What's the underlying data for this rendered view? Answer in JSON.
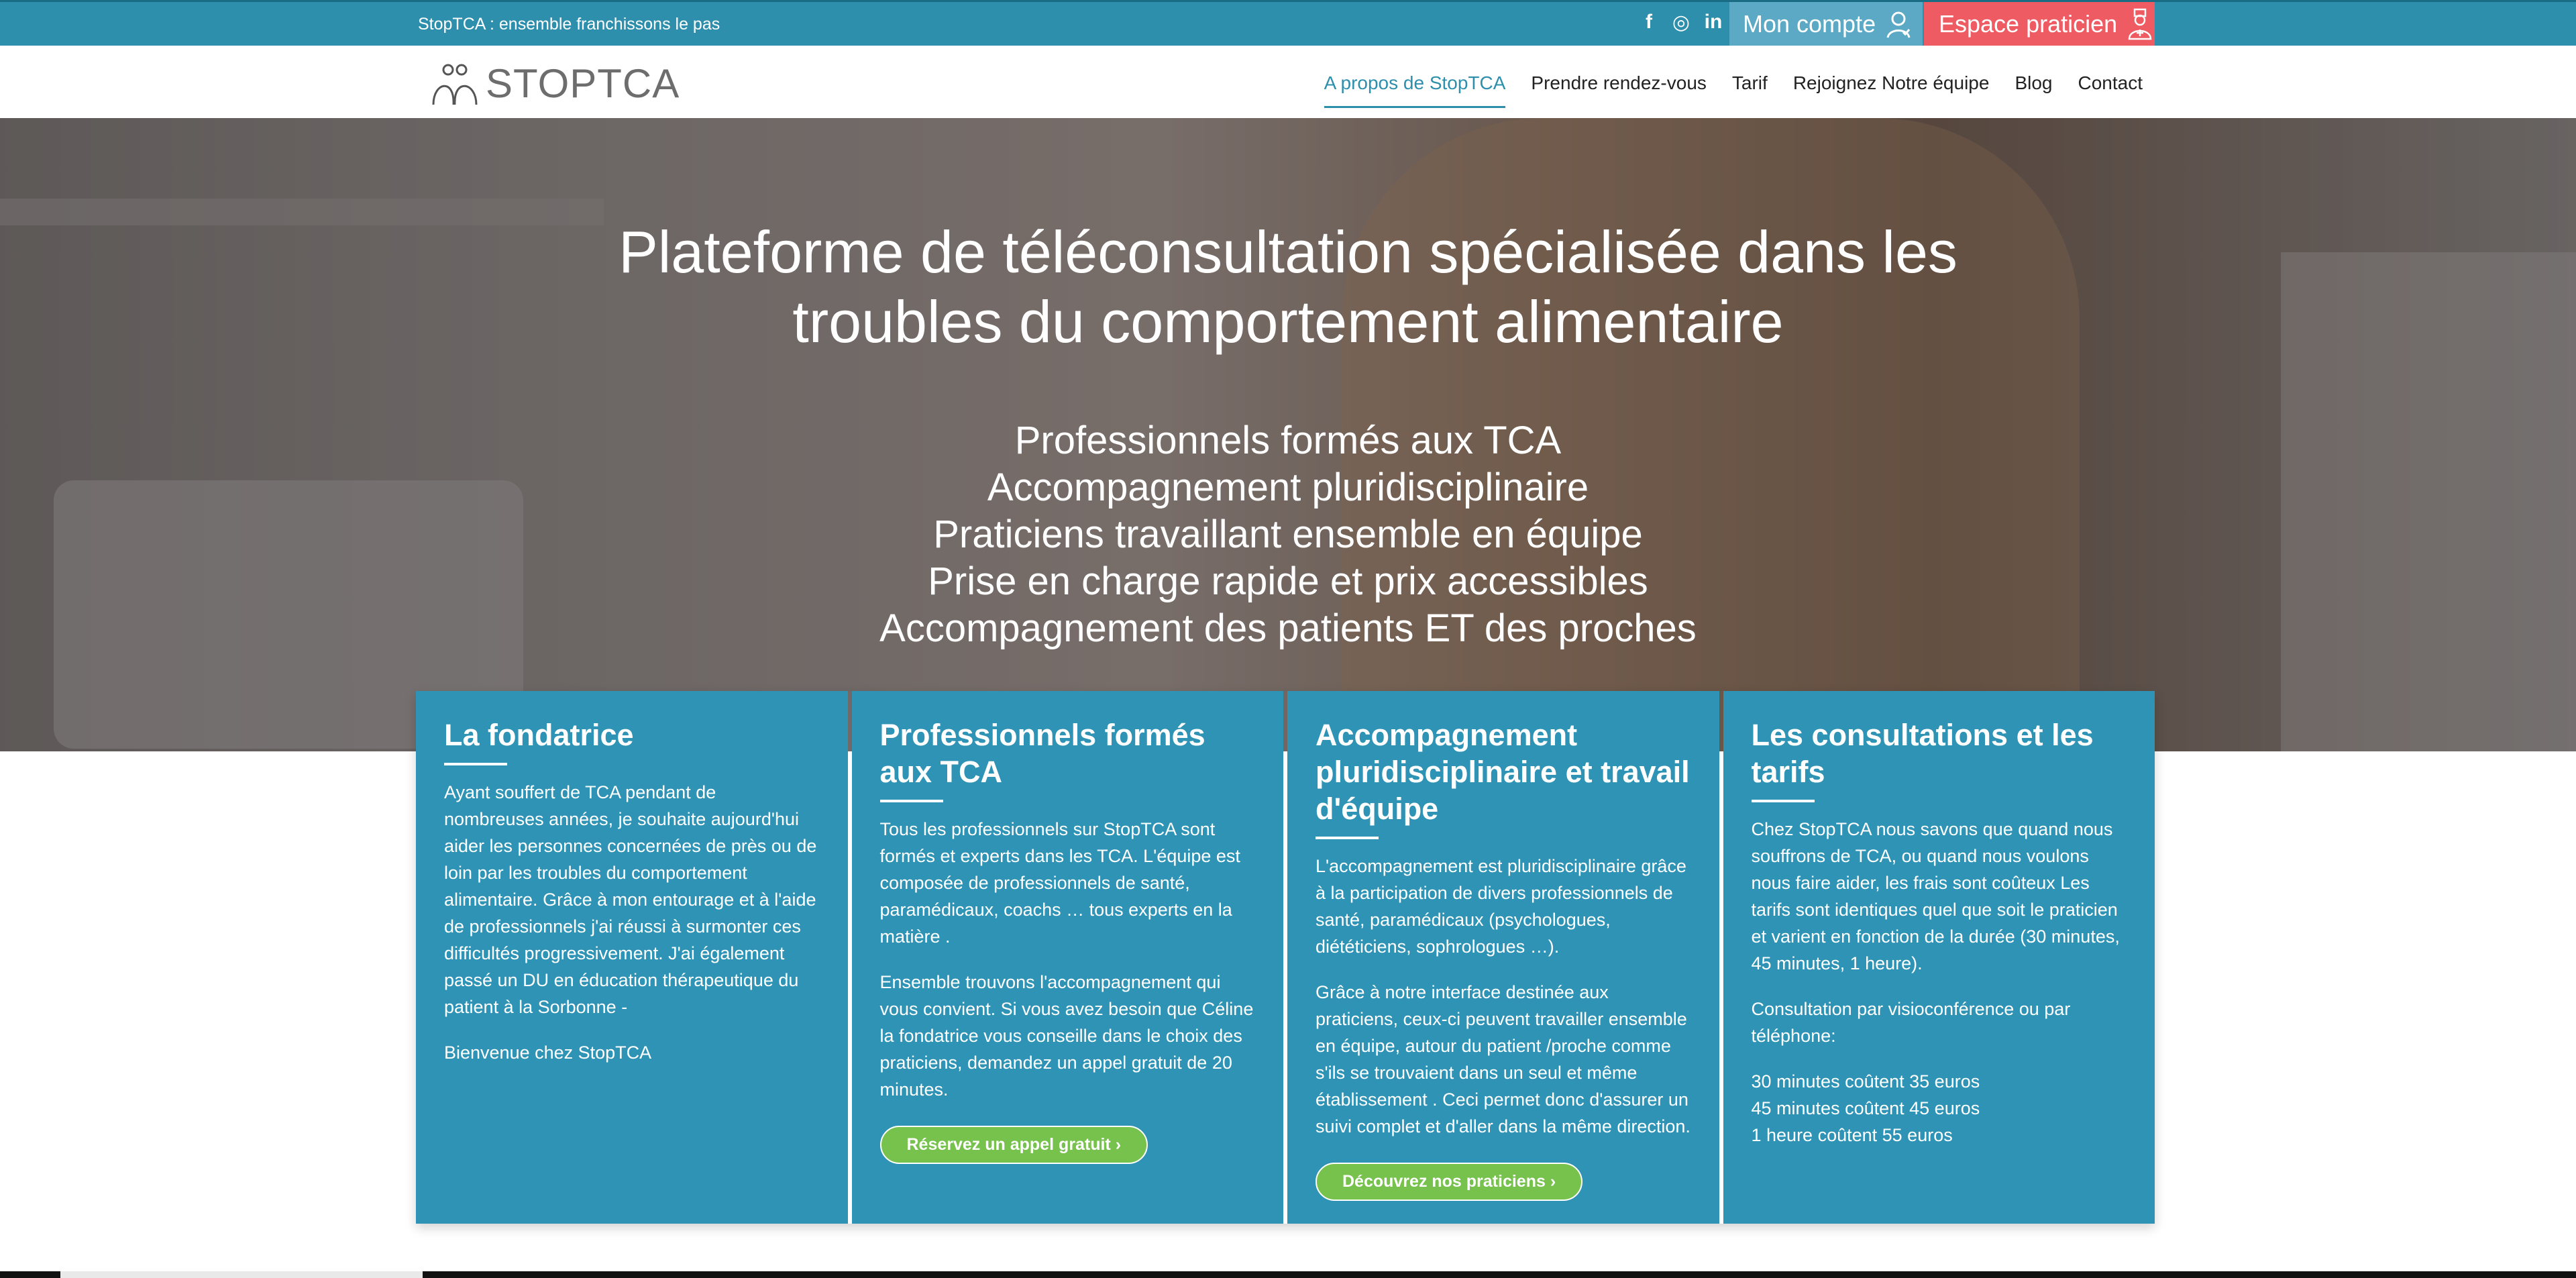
{
  "topbar": {
    "tagline": "StopTCA : ensemble franchissons le pas",
    "socials": [
      {
        "icon": "facebook-icon",
        "glyph": "f"
      },
      {
        "icon": "instagram-icon",
        "glyph": "◎"
      },
      {
        "icon": "linkedin-icon",
        "glyph": "in"
      }
    ],
    "account_label": "Mon compte",
    "praticien_label": "Espace praticien",
    "colors": {
      "bar": "#2e8fad",
      "account": "#5ba9c4",
      "praticien": "#ef5b63"
    }
  },
  "header": {
    "logo_text": "STOPTCA",
    "nav": [
      {
        "label": "A propos de StopTCA",
        "active": true
      },
      {
        "label": "Prendre rendez-vous",
        "active": false
      },
      {
        "label": "Tarif",
        "active": false
      },
      {
        "label": "Rejoignez Notre équipe",
        "active": false
      },
      {
        "label": "Blog",
        "active": false
      },
      {
        "label": "Contact",
        "active": false
      }
    ]
  },
  "hero": {
    "title_line1": "Plateforme de téléconsultation spécialisée dans les",
    "title_line2": "troubles du comportement alimentaire",
    "bullets": [
      "Professionnels formés aux TCA",
      "Accompagnement pluridisciplinaire",
      "Praticiens travaillant ensemble en équipe",
      "Prise en charge rapide et prix accessibles",
      "Accompagnement des patients ET des proches"
    ]
  },
  "cards": [
    {
      "title": "La fondatrice",
      "paragraphs": [
        "Ayant souffert de TCA pendant de nombreuses années, je souhaite aujourd'hui aider les personnes concernées de près ou de loin par les troubles du comportement alimentaire. Grâce à mon entourage et à l'aide de professionnels j'ai réussi à surmonter ces difficultés progressivement. J'ai également passé un DU en éducation thérapeutique du patient à la Sorbonne -",
        "Bienvenue chez StopTCA"
      ]
    },
    {
      "title": "Professionnels formés aux TCA",
      "paragraphs": [
        "Tous les professionnels sur StopTCA sont formés et experts dans les TCA. L'équipe est composée de professionnels de santé, paramédicaux, coachs … tous experts en la matière .",
        "Ensemble trouvons l'accompagnement qui vous convient. Si vous avez besoin que Céline la fondatrice vous conseille dans le choix des praticiens, demandez un appel gratuit de 20 minutes."
      ],
      "cta": "Réservez un appel gratuit ›"
    },
    {
      "title": "Accompagnement pluridisciplinaire et travail d'équipe",
      "paragraphs": [
        "L'accompagnement est pluridisciplinaire grâce à la participation de divers professionnels de santé, paramédicaux (psychologues, diététiciens, sophrologues …).",
        "Grâce à notre interface destinée aux praticiens, ceux-ci peuvent travailler ensemble en équipe, autour du patient /proche comme s'ils se trouvaient dans un seul et même établissement . Ceci permet donc d'assurer un suivi complet et d'aller dans la même direction."
      ],
      "cta": "Découvrez nos praticiens ›"
    },
    {
      "title": "Les consultations et les tarifs",
      "paragraphs": [
        "Chez StopTCA nous savons que quand nous souffrons de TCA, ou quand nous voulons nous faire aider, les frais sont coûteux Les tarifs sont identiques quel que soit le praticien et varient en fonction de la durée (30 minutes, 45 minutes, 1 heure).",
        "Consultation par visioconférence ou par téléphone:"
      ],
      "prices": [
        "30 minutes coûtent 35 euros",
        "45 minutes coûtent 45 euros",
        "1 heure coûtent 55 euros"
      ]
    }
  ],
  "colors": {
    "card": "#2e93b4",
    "cta": "#77c14d",
    "accent": "#2e8fad"
  }
}
